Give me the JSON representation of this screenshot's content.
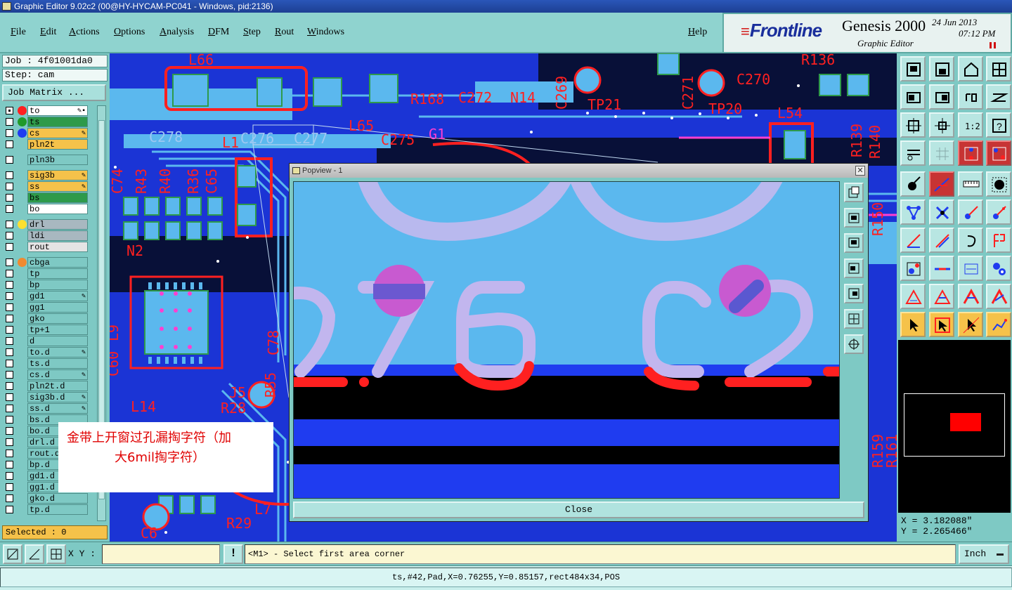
{
  "window": {
    "title": "Graphic Editor 9.02c2 (00@HY-HYCAM-PC041 - Windows, pid:2136)"
  },
  "menu": {
    "items": [
      "File",
      "Edit",
      "Actions",
      "Options",
      "Analysis",
      "DFM",
      "Step",
      "Rout",
      "Windows"
    ],
    "help": "Help"
  },
  "brand": {
    "logo": "Frontline",
    "product": "Genesis 2000",
    "subtitle": "Graphic Editor",
    "date": "24 Jun 2013",
    "time": "07:12 PM"
  },
  "job": {
    "job_label": "Job : 4f01001da0",
    "step_label": "Step: cam",
    "matrix_button": "Job Matrix ..."
  },
  "colors": {
    "copper_red": "#ff2020",
    "board_blue": "#1f3cf0",
    "panel_teal": "#7ec9c4",
    "highlight_yellow": "#f5c24a"
  },
  "layers": [
    {
      "name": "to",
      "bg": "#ffffff",
      "dot": "#ff2020",
      "marker": "✎▪",
      "active": true
    },
    {
      "name": "ts",
      "bg": "#2e9a4a",
      "dot": "#1f9a2a",
      "marker": ""
    },
    {
      "name": "cs",
      "bg": "#f5c24a",
      "dot": "#1f3cf0",
      "marker": "✎"
    },
    {
      "name": "pln2t",
      "bg": "#f5c24a",
      "dot": "",
      "marker": ""
    },
    {
      "name": "pln3b",
      "bg": "#7ec9c4",
      "dot": "",
      "marker": ""
    },
    {
      "name": "sig3b",
      "bg": "#f5c24a",
      "dot": "",
      "marker": "✎"
    },
    {
      "name": "ss",
      "bg": "#f5c24a",
      "dot": "",
      "marker": "✎"
    },
    {
      "name": "bs",
      "bg": "#2e9a4a",
      "dot": "",
      "marker": ""
    },
    {
      "name": "bo",
      "bg": "#ffffff",
      "dot": "",
      "marker": ""
    },
    {
      "name": "drl",
      "bg": "#a8b8c0",
      "dot": "#ffe030",
      "marker": ""
    },
    {
      "name": "ldi",
      "bg": "#a8b8c0",
      "dot": "",
      "marker": ""
    },
    {
      "name": "rout",
      "bg": "#e4e4e4",
      "dot": "",
      "marker": ""
    },
    {
      "name": "cbga",
      "bg": "#7ec9c4",
      "dot": "#f08a30",
      "marker": ""
    },
    {
      "name": "tp",
      "bg": "#7ec9c4",
      "dot": "",
      "marker": ""
    },
    {
      "name": "bp",
      "bg": "#7ec9c4",
      "dot": "",
      "marker": ""
    },
    {
      "name": "gd1",
      "bg": "#7ec9c4",
      "dot": "",
      "marker": "✎"
    },
    {
      "name": "gg1",
      "bg": "#7ec9c4",
      "dot": "",
      "marker": ""
    },
    {
      "name": "gko",
      "bg": "#7ec9c4",
      "dot": "",
      "marker": ""
    },
    {
      "name": "tp+1",
      "bg": "#7ec9c4",
      "dot": "",
      "marker": ""
    },
    {
      "name": "d",
      "bg": "#7ec9c4",
      "dot": "",
      "marker": ""
    },
    {
      "name": "to.d",
      "bg": "#7ec9c4",
      "dot": "",
      "marker": "✎"
    },
    {
      "name": "ts.d",
      "bg": "#7ec9c4",
      "dot": "",
      "marker": ""
    },
    {
      "name": "cs.d",
      "bg": "#7ec9c4",
      "dot": "",
      "marker": "✎"
    },
    {
      "name": "pln2t.d",
      "bg": "#7ec9c4",
      "dot": "",
      "marker": ""
    },
    {
      "name": "sig3b.d",
      "bg": "#7ec9c4",
      "dot": "",
      "marker": "✎"
    },
    {
      "name": "ss.d",
      "bg": "#7ec9c4",
      "dot": "",
      "marker": "✎"
    },
    {
      "name": "bs.d",
      "bg": "#7ec9c4",
      "dot": "",
      "marker": ""
    },
    {
      "name": "bo.d",
      "bg": "#7ec9c4",
      "dot": "",
      "marker": ""
    },
    {
      "name": "drl.d",
      "bg": "#7ec9c4",
      "dot": "",
      "marker": ""
    },
    {
      "name": "rout.d",
      "bg": "#7ec9c4",
      "dot": "",
      "marker": ""
    },
    {
      "name": "bp.d",
      "bg": "#7ec9c4",
      "dot": "",
      "marker": ""
    },
    {
      "name": "gd1.d",
      "bg": "#7ec9c4",
      "dot": "",
      "marker": ""
    },
    {
      "name": "gg1.d",
      "bg": "#7ec9c4",
      "dot": "",
      "marker": ""
    },
    {
      "name": "gko.d",
      "bg": "#7ec9c4",
      "dot": "",
      "marker": ""
    },
    {
      "name": "tp.d",
      "bg": "#7ec9c4",
      "dot": "",
      "marker": ""
    }
  ],
  "selected": "Selected : 0",
  "board_labels": [
    "L66",
    "R168",
    "C272",
    "N14",
    "C269",
    "TP21",
    "C271",
    "TP20",
    "C270",
    "R136",
    "L54",
    "C278",
    "L1",
    "C276",
    "C277",
    "L65",
    "C275",
    "G1",
    "R139",
    "R140",
    "C74",
    "R43",
    "R40",
    "R36",
    "C65",
    "N2",
    "R150",
    "L14",
    "J5",
    "R28",
    "R55",
    "C78",
    "R29",
    "L7",
    "C6",
    "R159",
    "R161",
    "C60",
    "L9"
  ],
  "annotation": {
    "line1": "金带上开窗过孔漏掏字符（加",
    "line2": "大6mil掏字符）"
  },
  "popview": {
    "title": "Popview - 1",
    "close_label": "Close",
    "glyphs": {
      "left": "276",
      "right": "C2"
    }
  },
  "tools": {
    "rows": [
      [
        "screen-up-icon",
        "screen-down-icon",
        "home-view-icon",
        "split-view-icon"
      ],
      [
        "pan-left-icon",
        "pan-right-icon",
        "rotate-icon",
        "zigzag-icon"
      ],
      [
        "zoom-fit-icon",
        "zoom-center-icon",
        "scale-1to2-icon",
        "help-icon"
      ],
      [
        "settings-icon",
        "grid-icon",
        "snap-a-icon",
        "snap-b-icon"
      ],
      [
        "select-feature-icon",
        "measure-angle-icon",
        "ruler-icon",
        "pad-icon"
      ],
      [
        "net-icon",
        "cross-icon",
        "route-a-icon",
        "route-b-icon"
      ],
      [
        "slope-a-icon",
        "slope-b-icon",
        "arc-icon",
        "split-pad-icon"
      ],
      [
        "pad-select-icon",
        "line-icon",
        "dimension-icon",
        "cluster-icon"
      ],
      [
        "triangle-a-icon",
        "triangle-b-icon",
        "triangle-c-icon",
        "triangle-d-icon"
      ],
      [
        "pointer-icon",
        "pointer-box-icon",
        "pointer-diag-icon",
        "pointer-net-icon"
      ]
    ]
  },
  "coords": {
    "x": "X = 3.182088\"",
    "y": "Y = 2.265466\""
  },
  "status": {
    "xy_label": "X Y :",
    "xy_value": "",
    "message": "<M1> - Select first area corner",
    "unit": "Inch",
    "feature_info": "ts,#42,Pad,X=0.76255,Y=0.85157,rect484x34,POS"
  }
}
